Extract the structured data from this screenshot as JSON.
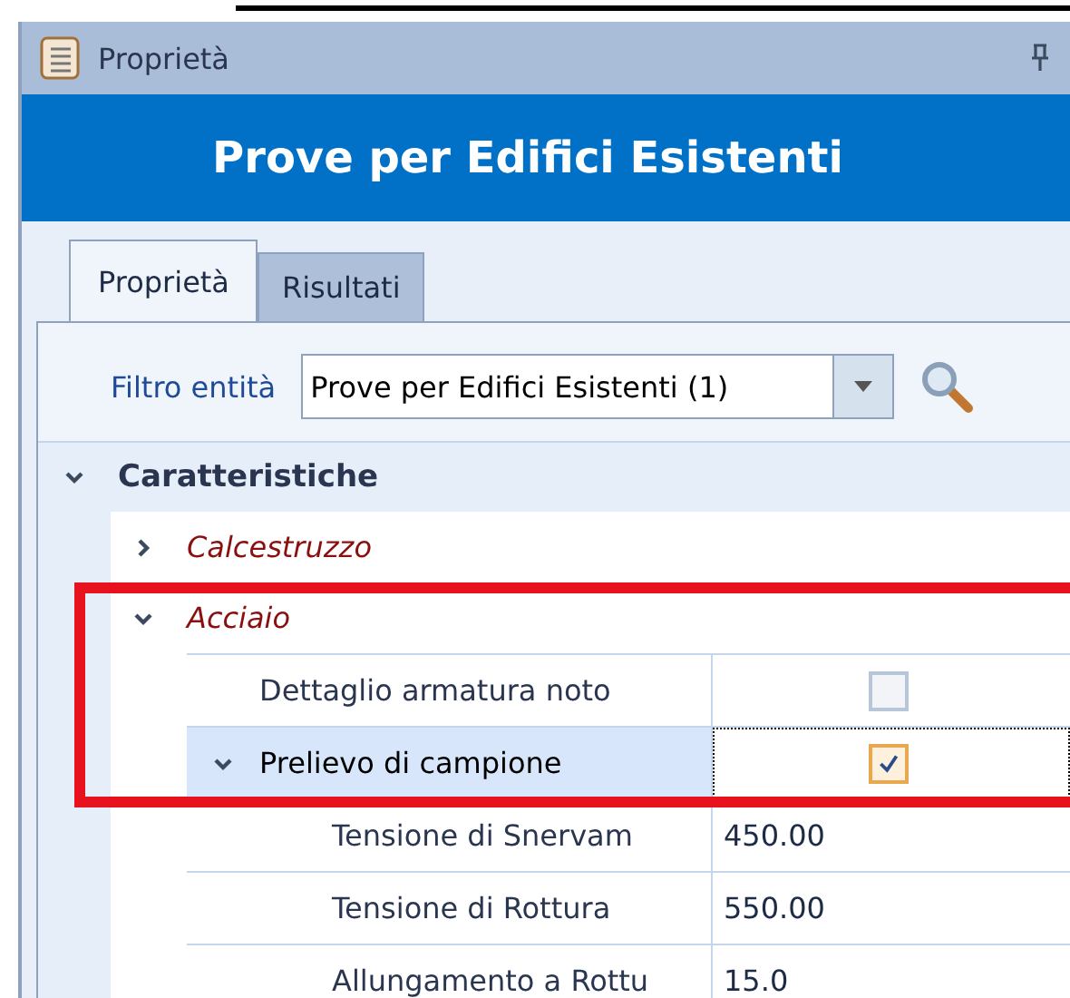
{
  "window": {
    "title": "Proprietà"
  },
  "header": {
    "title": "Prove per Edifici Esistenti"
  },
  "tabs": [
    {
      "label": "Proprietà",
      "selected": true
    },
    {
      "label": "Risultati",
      "selected": false
    }
  ],
  "filter": {
    "label": "Filtro entità",
    "value": "Prove per Edifici Esistenti (1)"
  },
  "categories": [
    {
      "label": "Caratteristiche",
      "expanded": true,
      "children": [
        {
          "label": "Calcestruzzo",
          "expanded": false
        },
        {
          "label": "Acciaio",
          "expanded": true,
          "properties": [
            {
              "kind": "checkbox",
              "label": "Dettaglio armatura noto",
              "checked": false,
              "selected": false
            },
            {
              "kind": "checkbox",
              "label": "Prelievo di campione",
              "checked": true,
              "selected": true,
              "expanded": true,
              "children": [
                {
                  "kind": "text",
                  "label": "Tensione di Snervam",
                  "value": "450.00",
                  "selected": false
                },
                {
                  "kind": "text",
                  "label": "Tensione di Rottura",
                  "value": "550.00",
                  "selected": false
                },
                {
                  "kind": "text",
                  "label": "Allungamento a Rottu",
                  "value": "15.0",
                  "selected": false
                }
              ]
            }
          ]
        }
      ]
    }
  ]
}
